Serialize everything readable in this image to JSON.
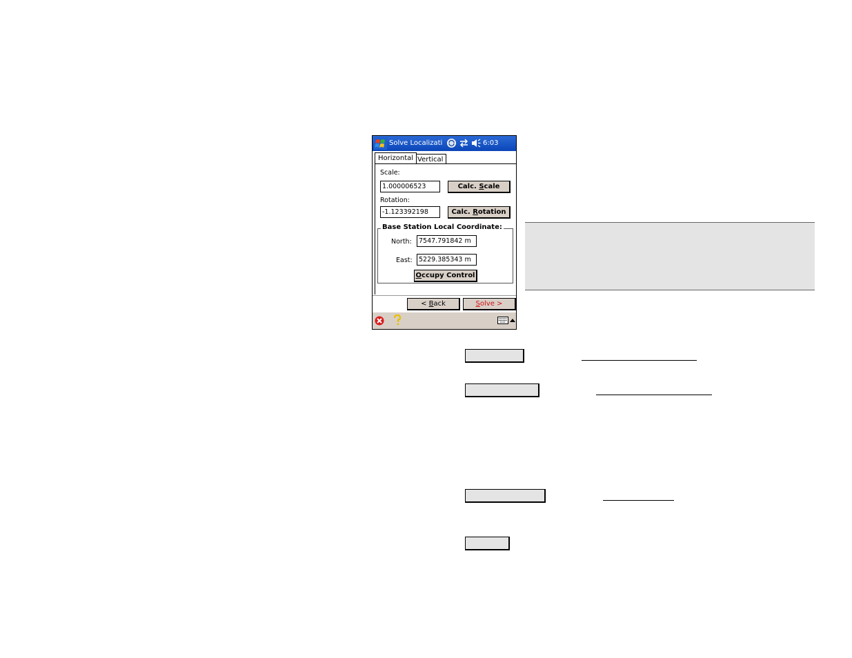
{
  "window": {
    "title": "Solve Localizati",
    "time": "6:03"
  },
  "tabs": [
    {
      "label": "Horizontal",
      "selected": true
    },
    {
      "label": "Vertical",
      "selected": false
    }
  ],
  "scale": {
    "label": "Scale:",
    "value": "1.000006523",
    "button_label": "Calc. Scale",
    "button_mnemonic": "S"
  },
  "rotation": {
    "label": "Rotation:",
    "value": "-1.123392198",
    "button_label": "Calc. Rotation",
    "button_mnemonic": "R"
  },
  "base_station": {
    "legend": "Base Station Local Coordinate:",
    "north_label": "North:",
    "north_value": "7547.791842 m",
    "east_label": "East:",
    "east_value": "5229.385343 m",
    "occupy_label": "Occupy Control",
    "occupy_mnemonic": "O"
  },
  "nav": {
    "back_label": "< Back",
    "back_mnemonic": "B",
    "solve_label": "Solve >",
    "solve_mnemonic": "S"
  },
  "icons": {
    "start": "windows-flag-icon",
    "sync": "sync-icon",
    "connection": "connection-arrows-icon",
    "volume": "speaker-icon",
    "close": "close-icon",
    "help": "help-question-icon",
    "keyboard": "keyboard-icon",
    "input_menu": "arrow-up-icon"
  },
  "colors": {
    "titlebar": "#0b46b8",
    "bar": "#d8cfc7",
    "accent_red": "#d01010",
    "note_bg": "#e4e4e4"
  }
}
